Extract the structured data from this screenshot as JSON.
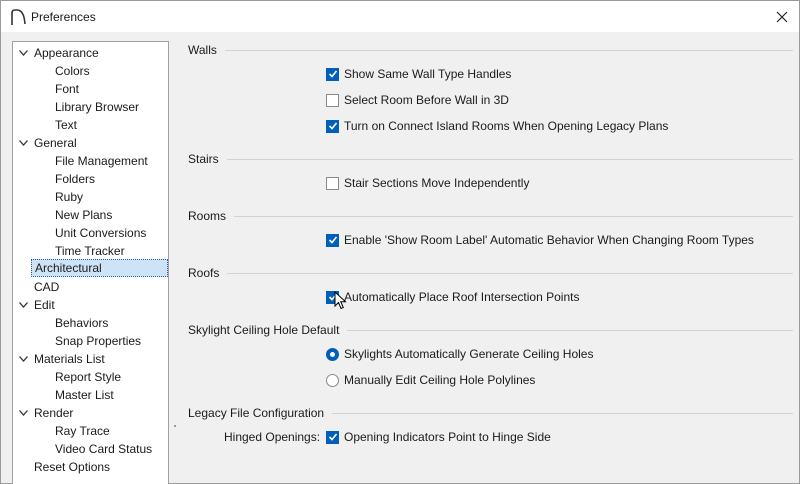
{
  "window": {
    "title": "Preferences"
  },
  "tree": [
    {
      "label": "Appearance",
      "level": 0,
      "expanded": true
    },
    {
      "label": "Colors",
      "level": 1
    },
    {
      "label": "Font",
      "level": 1
    },
    {
      "label": "Library Browser",
      "level": 1
    },
    {
      "label": "Text",
      "level": 1
    },
    {
      "label": "General",
      "level": 0,
      "expanded": true
    },
    {
      "label": "File Management",
      "level": 1
    },
    {
      "label": "Folders",
      "level": 1
    },
    {
      "label": "Ruby",
      "level": 1
    },
    {
      "label": "New Plans",
      "level": 1
    },
    {
      "label": "Unit Conversions",
      "level": 1
    },
    {
      "label": "Time Tracker",
      "level": 1
    },
    {
      "label": "Architectural",
      "level": 0,
      "selected": true
    },
    {
      "label": "CAD",
      "level": 0
    },
    {
      "label": "Edit",
      "level": 0,
      "expanded": true
    },
    {
      "label": "Behaviors",
      "level": 1
    },
    {
      "label": "Snap Properties",
      "level": 1
    },
    {
      "label": "Materials List",
      "level": 0,
      "expanded": true
    },
    {
      "label": "Report Style",
      "level": 1
    },
    {
      "label": "Master List",
      "level": 1
    },
    {
      "label": "Render",
      "level": 0,
      "expanded": true
    },
    {
      "label": "Ray Trace",
      "level": 1
    },
    {
      "label": "Video Card Status",
      "level": 1
    },
    {
      "label": "Reset Options",
      "level": 0
    }
  ],
  "sections": {
    "walls": {
      "title": "Walls",
      "options": [
        {
          "label": "Show Same Wall Type Handles",
          "checked": true
        },
        {
          "label": "Select Room Before Wall in 3D",
          "checked": false
        },
        {
          "label": "Turn on Connect Island Rooms When Opening Legacy Plans",
          "checked": true
        }
      ]
    },
    "stairs": {
      "title": "Stairs",
      "options": [
        {
          "label": "Stair Sections Move Independently",
          "checked": false
        }
      ]
    },
    "rooms": {
      "title": "Rooms",
      "options": [
        {
          "label": "Enable 'Show Room Label' Automatic Behavior When Changing Room Types",
          "checked": true
        }
      ]
    },
    "roofs": {
      "title": "Roofs",
      "options": [
        {
          "label": "Automatically Place Roof Intersection Points",
          "checked": true
        }
      ]
    },
    "skylight": {
      "title": "Skylight Ceiling Hole Default",
      "options": [
        {
          "label": "Skylights Automatically Generate Ceiling Holes",
          "selected": true
        },
        {
          "label": "Manually Edit Ceiling Hole Polylines",
          "selected": false
        }
      ]
    },
    "legacy": {
      "title": "Legacy File Configuration",
      "hinged_label": "Hinged Openings:",
      "options": [
        {
          "label": "Opening Indicators Point to Hinge Side",
          "checked": true
        }
      ]
    }
  },
  "colors": {
    "accent": "#005fb8",
    "selection_bg": "#cfe3f7"
  }
}
